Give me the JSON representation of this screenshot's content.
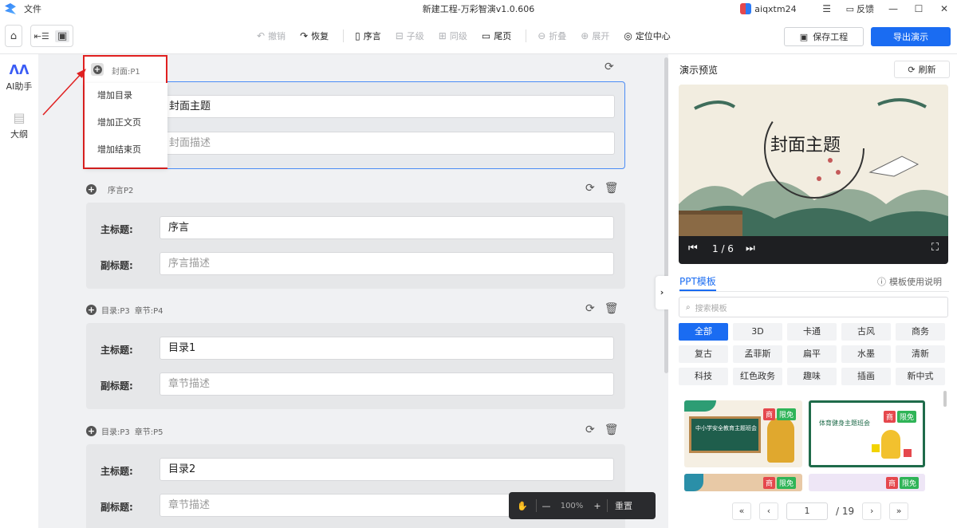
{
  "titlebar": {
    "menu": "文件",
    "title": "新建工程-万彩智演v1.0.606",
    "user": "aiqxtm24",
    "menu_icon": "☰",
    "feedback": "反馈",
    "minimize": "—",
    "maximize": "☐",
    "close": "✕"
  },
  "toolbar": {
    "undo": "撤销",
    "redo": "恢复",
    "preface": "序言",
    "child": "子级",
    "sibling": "同级",
    "end_page": "尾页",
    "collapse": "折叠",
    "expand": "展开",
    "locate": "定位中心",
    "save": "保存工程",
    "export": "导出演示"
  },
  "leftnav": {
    "ai": "AI助手",
    "outline": "大纲"
  },
  "context_menu": {
    "title": "封面:P1",
    "items": [
      "增加目录",
      "增加正文页",
      "增加结束页"
    ]
  },
  "cover": {
    "title_value": "封面主题",
    "desc_placeholder": "封面描述"
  },
  "sections": [
    {
      "head": "序言P2",
      "title_label": "主标题:",
      "title_value": "序言",
      "sub_label": "副标题:",
      "sub_placeholder": "序言描述"
    },
    {
      "head": "目录:P3",
      "head2": "章节:P4",
      "title_label": "主标题:",
      "title_value": "目录1",
      "sub_label": "副标题:",
      "sub_placeholder": "章节描述"
    },
    {
      "head": "目录:P3",
      "head2": "章节:P5",
      "title_label": "主标题:",
      "title_value": "目录2",
      "sub_label": "副标题:",
      "sub_placeholder": "章节描述"
    }
  ],
  "zoom": {
    "value": "100%",
    "reset": "重置"
  },
  "preview": {
    "heading": "演示预览",
    "refresh": "刷新",
    "slide_title": "封面主题",
    "counter": "1 / 6"
  },
  "templates": {
    "tab": "PPT模板",
    "help": "模板使用说明",
    "search_placeholder": "搜索模板",
    "categories": [
      "全部",
      "3D",
      "卡通",
      "古风",
      "商务",
      "复古",
      "孟菲斯",
      "扁平",
      "水墨",
      "清新",
      "科技",
      "红色政务",
      "趣味",
      "插画",
      "新中式"
    ],
    "badge_a": "商",
    "badge_b": "限免",
    "t1_text": "中小学安全教育主题班会",
    "t2_text": "体育健身主题班会"
  },
  "pager": {
    "current": "1",
    "total": "/ 19"
  }
}
